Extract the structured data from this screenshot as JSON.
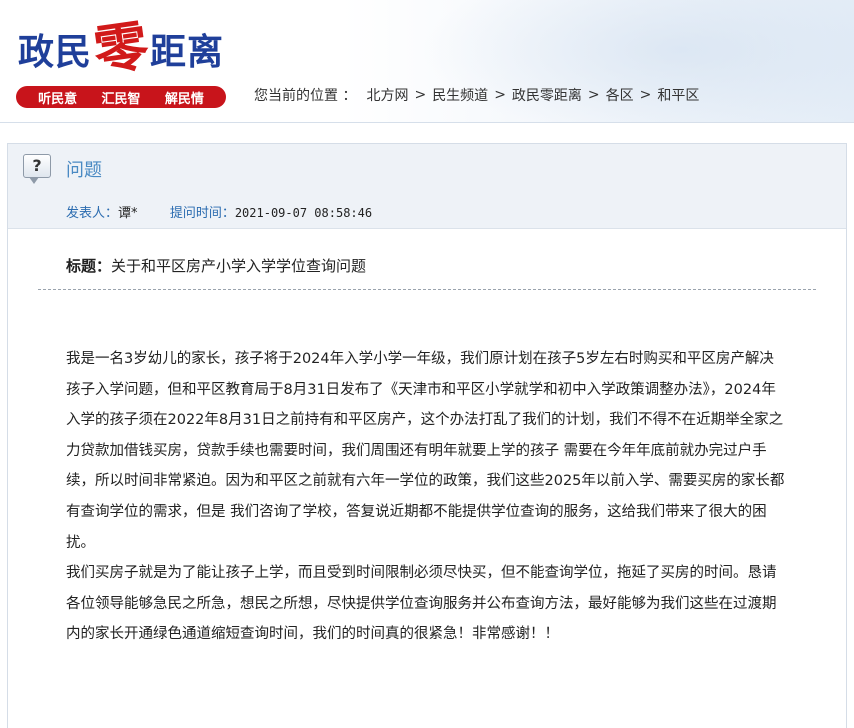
{
  "header": {
    "logo": {
      "part1": "政民",
      "accent": "零",
      "part2": "距离"
    },
    "slogans": [
      "听民意",
      "汇民智",
      "解民情"
    ],
    "breadcrumb": {
      "label": "您当前的位置 ：",
      "items": [
        "北方网",
        "民生频道",
        "政民零距离",
        "各区",
        "和平区"
      ]
    }
  },
  "panel": {
    "title": "问题",
    "poster_label": "发表人：",
    "poster": "谭*",
    "time_label": "提问时间：",
    "time": "2021-09-07 08:58:46",
    "subject_label": "标题：",
    "subject": "关于和平区房产小学入学学位查询问题",
    "paragraphs": [
      "我是一名3岁幼儿的家长，孩子将于2024年入学小学一年级，我们原计划在孩子5岁左右时购买和平区房产解决孩子入学问题，但和平区教育局于8月31日发布了《天津市和平区小学就学和初中入学政策调整办法》，2024年入学的孩子须在2022年8月31日之前持有和平区房产，这个办法打乱了我们的计划，我们不得不在近期举全家之力贷款加借钱买房，贷款手续也需要时间，我们周围还有明年就要上学的孩子 需要在今年年底前就办完过户手续，所以时间非常紧迫。因为和平区之前就有六年一学位的政策，我们这些2025年以前入学、需要买房的家长都有查询学位的需求，但是 我们咨询了学校，答复说近期都不能提供学位查询的服务，这给我们带来了很大的困扰。",
      "我们买房子就是为了能让孩子上学，而且受到时间限制必须尽快买，但不能查询学位，拖延了买房的时间。恳请各位领导能够急民之所急，想民之所想，尽快提供学位查询服务并公布查询方法，最好能够为我们这些在过渡期内的家长开通绿色通道缩短查询时间，我们的时间真的很紧急！非常感谢！！"
    ]
  },
  "colors": {
    "logo_blue": "#1f3f9a",
    "logo_red": "#d11a1a",
    "slogan_bg": "#c8141b",
    "title_blue": "#4a8ac3",
    "meta_blue": "#2b6cb0"
  },
  "icons": {
    "question": "question-icon"
  }
}
